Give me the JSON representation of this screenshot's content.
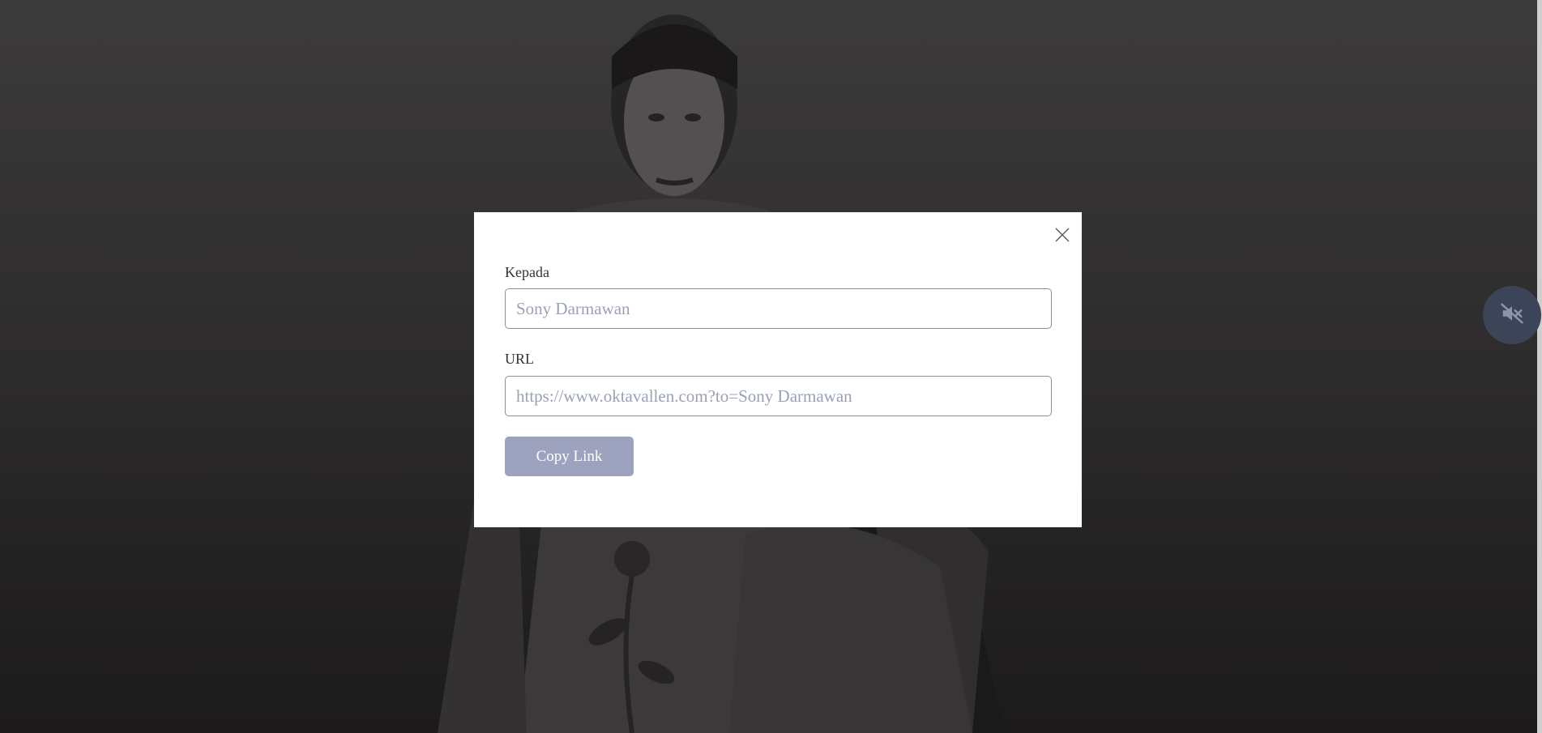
{
  "modal": {
    "recipient_label": "Kepada",
    "recipient_placeholder": "Sony Darmawan",
    "url_label": "URL",
    "url_placeholder": "https://www.oktavallen.com?to=Sony Darmawan",
    "copy_button_label": "Copy Link",
    "close_icon": "close-icon"
  },
  "audio": {
    "mute_icon": "speaker-muted-icon"
  },
  "colors": {
    "button_bg": "#9da3be",
    "mute_bg": "#3c4458",
    "input_text": "#9aa0b8"
  }
}
